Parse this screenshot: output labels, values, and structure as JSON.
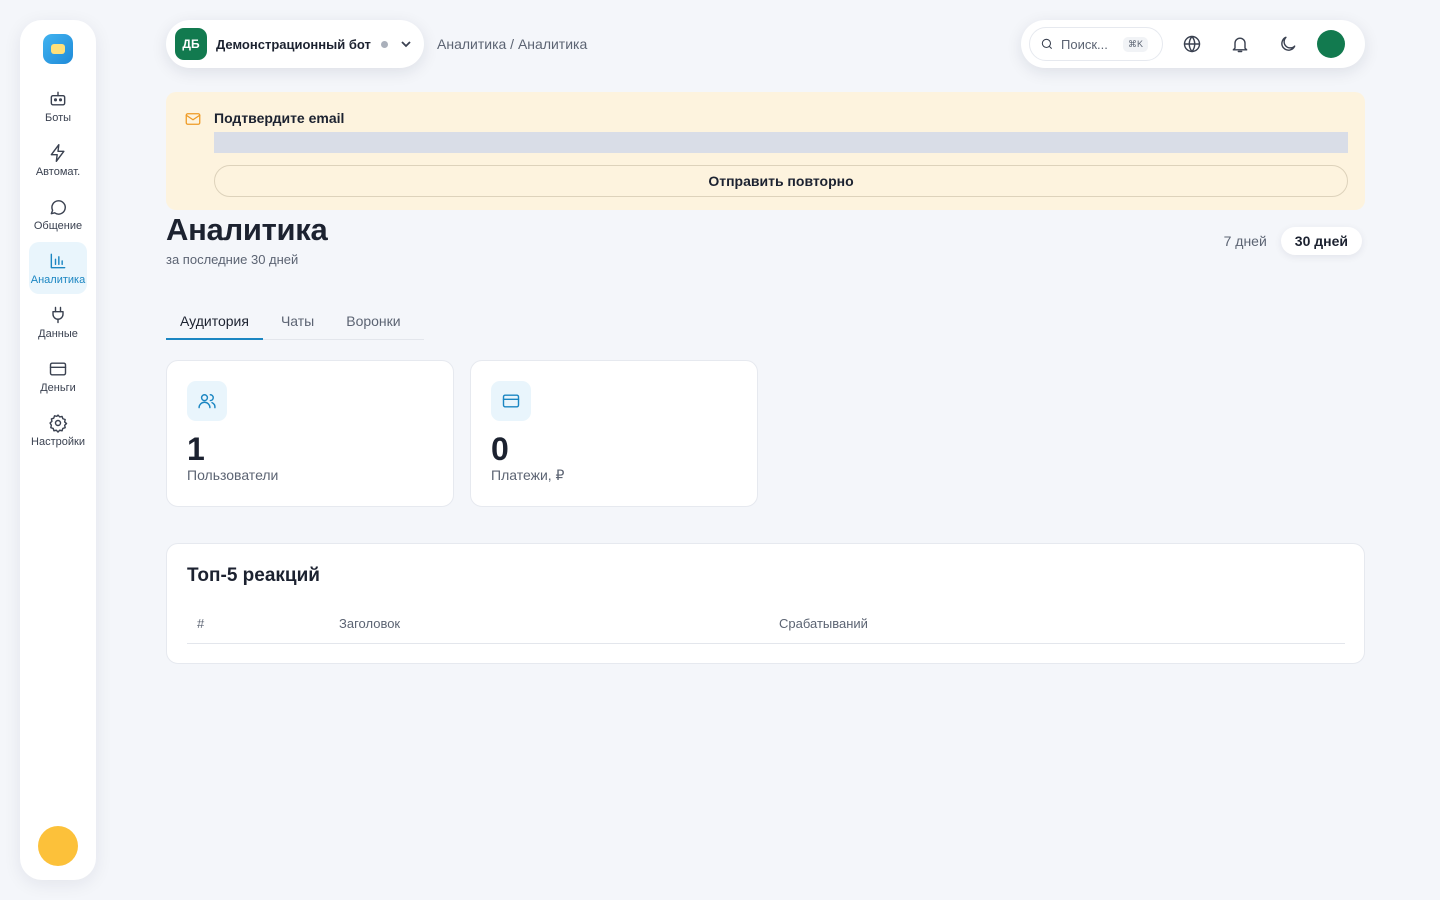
{
  "sidebar": {
    "items": [
      {
        "label": "Боты",
        "icon": "robot-icon"
      },
      {
        "label": "Автомат.",
        "icon": "lightning-icon"
      },
      {
        "label": "Общение",
        "icon": "chat-bubble-icon"
      },
      {
        "label": "Аналитика",
        "icon": "bar-chart-icon",
        "active": true
      },
      {
        "label": "Данные",
        "icon": "plug-icon"
      },
      {
        "label": "Деньги",
        "icon": "credit-card-icon"
      },
      {
        "label": "Настройки",
        "icon": "gear-icon"
      }
    ]
  },
  "header": {
    "bot": {
      "initials": "ДБ",
      "name": "Демонстрационный бот"
    },
    "breadcrumb": "Аналитика / Аналитика",
    "search": {
      "placeholder": "Поиск...",
      "shortcut": "⌘K"
    }
  },
  "banner": {
    "title": "Подтвердите email",
    "button_label": "Отправить повторно"
  },
  "page": {
    "title": "Аналитика",
    "subtitle": "за последние 30 дней",
    "ranges": [
      "7 дней",
      "30 дней"
    ],
    "active_range": "30 дней"
  },
  "tabs": [
    "Аудитория",
    "Чаты",
    "Воронки"
  ],
  "stats": [
    {
      "value": "1",
      "label": "Пользователи",
      "icon": "users-icon"
    },
    {
      "value": "0",
      "label": "Платежи, ₽",
      "icon": "credit-card-icon"
    }
  ],
  "top_reactions": {
    "title": "Топ-5 реакций",
    "columns": [
      "#",
      "Заголовок",
      "Срабатываний"
    ]
  },
  "colors": {
    "accent": "#1b86c2",
    "bot_avatar": "#127a4f",
    "banner_bg": "#fdf3de",
    "banner_icon": "#ee9a24",
    "user_avatar": "#fcc13a"
  }
}
